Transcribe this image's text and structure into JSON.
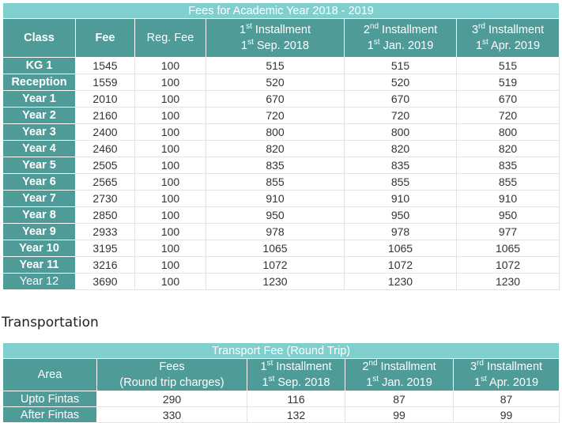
{
  "fees_table": {
    "caption": "Fees for Academic Year 2018 - 2019",
    "headers": {
      "class": "Class",
      "fee": "Fee",
      "reg_fee": "Reg. Fee",
      "inst1": {
        "num": "1",
        "sup": "st",
        "word": " Installment",
        "date_num": "1",
        "date_sup": "st",
        "date_rest": " Sep. 2018"
      },
      "inst2": {
        "num": "2",
        "sup": "nd",
        "word": " Installment",
        "date_num": "1",
        "date_sup": "st",
        "date_rest": " Jan. 2019"
      },
      "inst3": {
        "num": "3",
        "sup": "rd",
        "word": " Installment",
        "date_num": "1",
        "date_sup": "st",
        "date_rest": " Apr. 2019"
      }
    },
    "rows": [
      {
        "class": "KG 1",
        "fee": "1545",
        "reg": "100",
        "i1": "515",
        "i2": "515",
        "i3": "515"
      },
      {
        "class": "Reception",
        "fee": "1559",
        "reg": "100",
        "i1": "520",
        "i2": "520",
        "i3": "519"
      },
      {
        "class": "Year 1",
        "fee": "2010",
        "reg": "100",
        "i1": "670",
        "i2": "670",
        "i3": "670"
      },
      {
        "class": "Year 2",
        "fee": "2160",
        "reg": "100",
        "i1": "720",
        "i2": "720",
        "i3": "720"
      },
      {
        "class": "Year 3",
        "fee": "2400",
        "reg": "100",
        "i1": "800",
        "i2": "800",
        "i3": "800"
      },
      {
        "class": "Year 4",
        "fee": "2460",
        "reg": "100",
        "i1": "820",
        "i2": "820",
        "i3": "820"
      },
      {
        "class": "Year 5",
        "fee": "2505",
        "reg": "100",
        "i1": "835",
        "i2": "835",
        "i3": "835"
      },
      {
        "class": "Year 6",
        "fee": "2565",
        "reg": "100",
        "i1": "855",
        "i2": "855",
        "i3": "855"
      },
      {
        "class": "Year 7",
        "fee": "2730",
        "reg": "100",
        "i1": "910",
        "i2": "910",
        "i3": "910"
      },
      {
        "class": "Year 8",
        "fee": "2850",
        "reg": "100",
        "i1": "950",
        "i2": "950",
        "i3": "950"
      },
      {
        "class": "Year 9",
        "fee": "2933",
        "reg": "100",
        "i1": "978",
        "i2": "978",
        "i3": "977"
      },
      {
        "class": "Year 10",
        "fee": "3195",
        "reg": "100",
        "i1": "1065",
        "i2": "1065",
        "i3": "1065"
      },
      {
        "class": "Year 11",
        "fee": "3216",
        "reg": "100",
        "i1": "1072",
        "i2": "1072",
        "i3": "1072"
      },
      {
        "class": "Year 12",
        "fee": "3690",
        "reg": "100",
        "i1": "1230",
        "i2": "1230",
        "i3": "1230"
      }
    ]
  },
  "transport_heading": "Transportation",
  "transport_table": {
    "caption": "Transport Fee (Round Trip)",
    "headers": {
      "area": "Area",
      "fees_line1": "Fees",
      "fees_line2": "(Round trip charges)",
      "inst1": {
        "num": "1",
        "sup": "st",
        "word": " Installment",
        "date_num": "1",
        "date_sup": "st",
        "date_rest": " Sep. 2018"
      },
      "inst2": {
        "num": "2",
        "sup": "nd",
        "word": " Installment",
        "date_num": "1",
        "date_sup": "st",
        "date_rest": " Jan. 2019"
      },
      "inst3": {
        "num": "3",
        "sup": "rd",
        "word": " Installment",
        "date_num": "1",
        "date_sup": "st",
        "date_rest": " Apr. 2019"
      }
    },
    "rows": [
      {
        "area": "Upto Fintas",
        "fees": "290",
        "i1": "116",
        "i2": "87",
        "i3": "87"
      },
      {
        "area": "After Fintas",
        "fees": "330",
        "i1": "132",
        "i2": "99",
        "i3": "99"
      }
    ]
  },
  "colors": {
    "caption_bg": "#7fcfce",
    "header_bg": "#4f9b98",
    "text": "#333333"
  }
}
